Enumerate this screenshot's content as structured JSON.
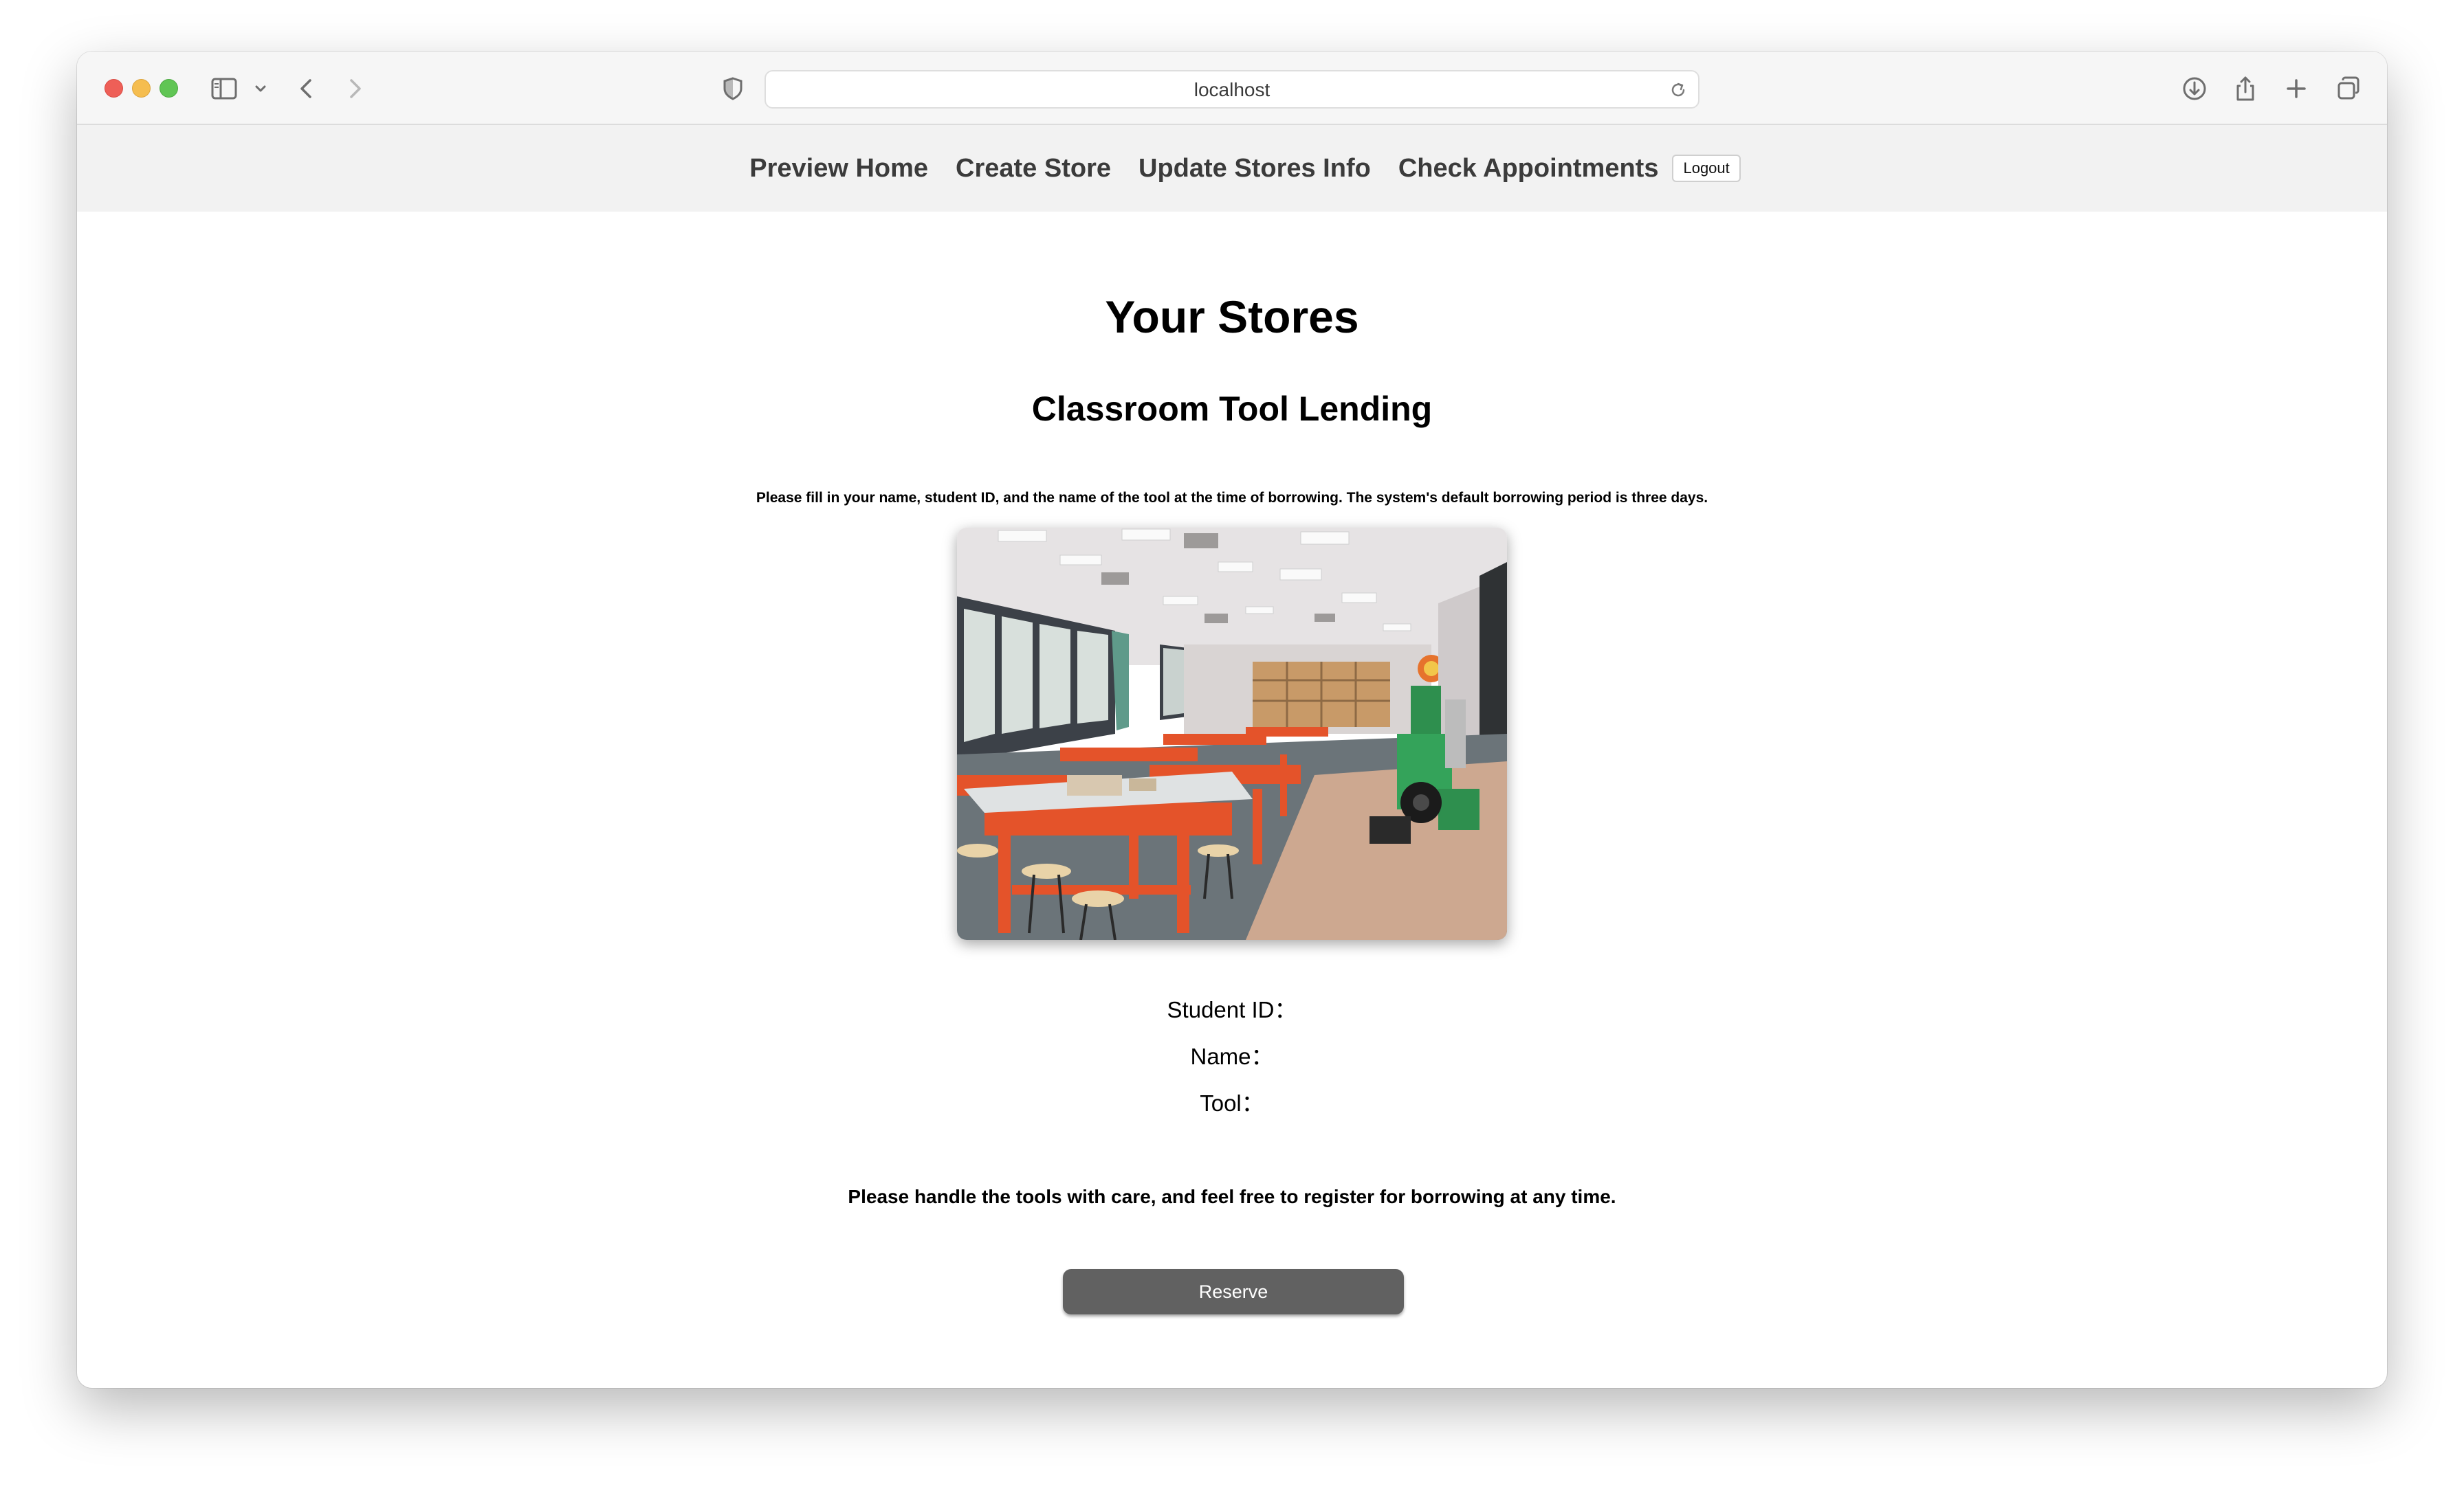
{
  "browser": {
    "url": "localhost",
    "icons": [
      "sidebar-icon",
      "chevron-down-icon",
      "back-icon",
      "forward-icon",
      "shield-icon",
      "reload-icon",
      "download-icon",
      "share-icon",
      "new-tab-icon",
      "tabs-overview-icon"
    ]
  },
  "nav": {
    "links": [
      "Preview Home",
      "Create Store",
      "Update Stores Info",
      "Check Appointments"
    ],
    "logout": "Logout"
  },
  "page": {
    "title": "Your Stores",
    "store_name": "Classroom Tool Lending",
    "store_description": "Please fill in your name, student ID, and the name of the tool at the time of borrowing. The system's default borrowing period is three days.",
    "fields": [
      "Student ID：",
      "Name：",
      "Tool："
    ],
    "note": "Please handle the tools with care, and feel free to register for borrowing at any time.",
    "reserve_button": "Reserve"
  }
}
